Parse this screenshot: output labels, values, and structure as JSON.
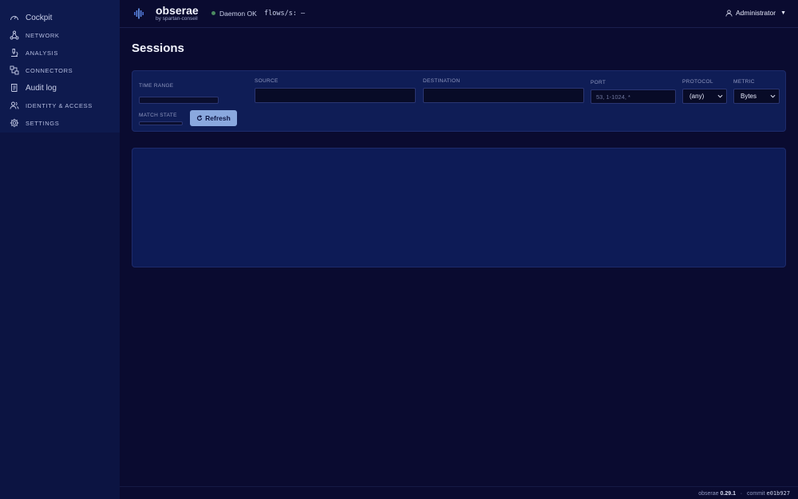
{
  "sidebar": {
    "items": [
      {
        "label": "Cockpit",
        "icon": "gauge-icon"
      },
      {
        "label": "NETWORK",
        "icon": "network-icon"
      },
      {
        "label": "ANALYSIS",
        "icon": "microscope-icon"
      },
      {
        "label": "CONNECTORS",
        "icon": "connectors-icon"
      },
      {
        "label": "Audit log",
        "icon": "scroll-icon"
      },
      {
        "label": "IDENTITY & ACCESS",
        "icon": "users-icon"
      },
      {
        "label": "SETTINGS",
        "icon": "gear-icon"
      }
    ]
  },
  "header": {
    "brand": "obserae",
    "subtitle": "by spartan-conseil",
    "status": "Daemon OK",
    "flows": "flows/s: —",
    "user": "Administrator",
    "status_color": "#4c8a60"
  },
  "page": {
    "title": "Sessions"
  },
  "filters": {
    "time_range_label": "TIME RANGE",
    "source_label": "SOURCE",
    "destination_label": "DESTINATION",
    "port_label": "PORT",
    "port_placeholder": "53, 1-1024, *",
    "protocol_label": "PROTOCOL",
    "protocol_value": "(any)",
    "metric_label": "METRIC",
    "metric_value": "Bytes",
    "match_state_label": "MATCH STATE",
    "refresh_label": "Refresh",
    "button_color": "#8aa8de"
  },
  "footer": {
    "product": "obserae",
    "version": "0.29.1",
    "commit_label": "commit",
    "commit": "e01b927"
  }
}
